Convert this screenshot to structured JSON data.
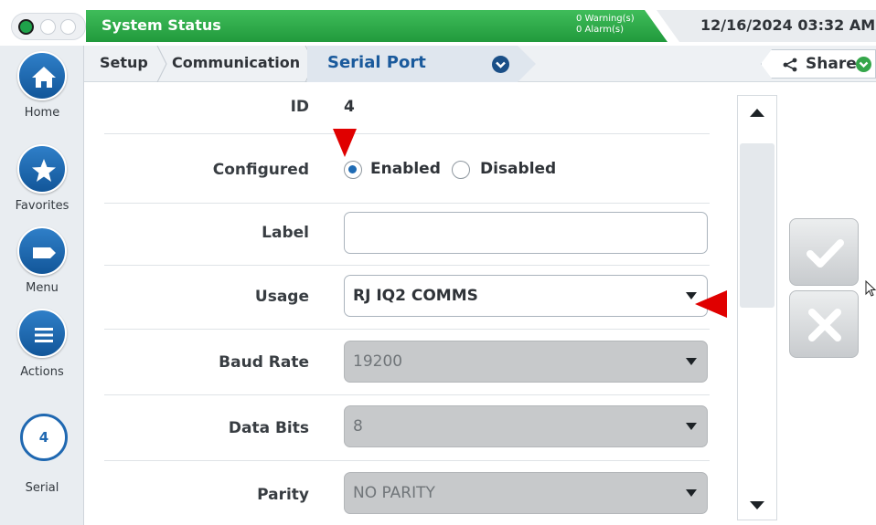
{
  "window_controls": [
    "close",
    "minimize",
    "maximize"
  ],
  "status_bar": {
    "title": "System Status",
    "warnings": "0 Warning(s)",
    "alarms": "0 Alarm(s)"
  },
  "datetime": "12/16/2024 03:32 AM",
  "breadcrumb": {
    "items": [
      "Setup",
      "Communication",
      "Serial Port"
    ],
    "share": "Share"
  },
  "sidebar": {
    "items": [
      {
        "label": "Home",
        "icon": "home-icon"
      },
      {
        "label": "Favorites",
        "icon": "star-icon"
      },
      {
        "label": "Menu",
        "icon": "menu-icon"
      },
      {
        "label": "Actions",
        "icon": "list-icon"
      }
    ],
    "serial": {
      "number": "4",
      "label": "Serial"
    }
  },
  "form": {
    "id": {
      "label": "ID",
      "value": "4"
    },
    "configured": {
      "label": "Configured",
      "options": [
        "Enabled",
        "Disabled"
      ],
      "selected": "Enabled"
    },
    "label_field": {
      "label": "Label",
      "value": ""
    },
    "usage": {
      "label": "Usage",
      "value": "RJ IQ2 COMMS",
      "enabled": true
    },
    "baud_rate": {
      "label": "Baud Rate",
      "value": "19200",
      "enabled": false
    },
    "data_bits": {
      "label": "Data Bits",
      "value": "8",
      "enabled": false
    },
    "parity": {
      "label": "Parity",
      "value": "NO PARITY",
      "enabled": false
    }
  },
  "colors": {
    "status_green": "#2fae4b",
    "accent_blue": "#1a5a9c",
    "marker_red": "#e00000"
  }
}
